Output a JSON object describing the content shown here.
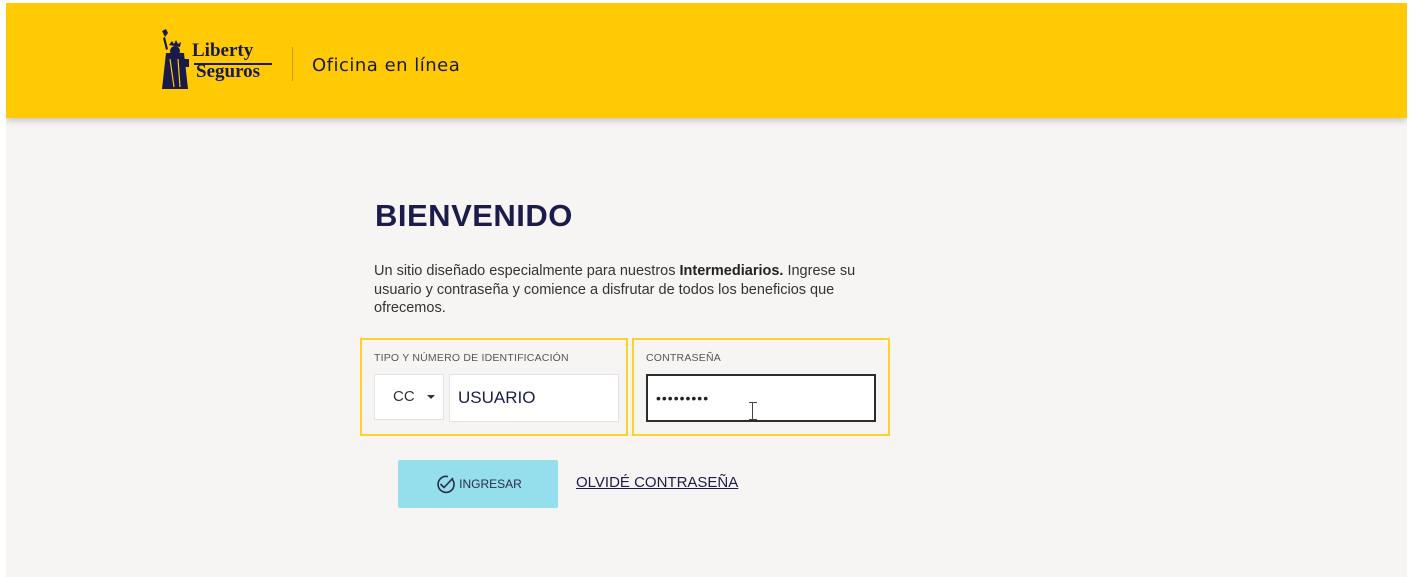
{
  "header": {
    "logo_line1": "Liberty",
    "logo_line2": "Seguros",
    "office_title": "Oficina en línea"
  },
  "main": {
    "title": "BIENVENIDO",
    "desc_part1": "Un sitio diseñado especialmente para nuestros ",
    "desc_bold": "Intermediarios.",
    "desc_part2": " Ingrese su usuario y contraseña y comience a disfrutar de todos los beneficios que ofrecemos."
  },
  "form": {
    "id_label": "TIPO Y NÚMERO DE IDENTIFICACIÓN",
    "id_type_value": "CC",
    "username_value": "USUARIO",
    "password_label": "CONTRASEÑA",
    "password_value": "•••••••••",
    "submit_label": "INGRESAR",
    "forgot_label": "OLVIDÉ CONTRASEÑA"
  },
  "colors": {
    "header_bg": "#ffca03",
    "focus_border": "#fdd22b",
    "button_bg": "#95deeb",
    "title_color": "#1c1c4c"
  },
  "icons": {
    "logo": "statue-of-liberty-icon",
    "dropdown": "caret-down-icon",
    "submit": "check-circle-icon",
    "cursor": "text-cursor-icon"
  }
}
